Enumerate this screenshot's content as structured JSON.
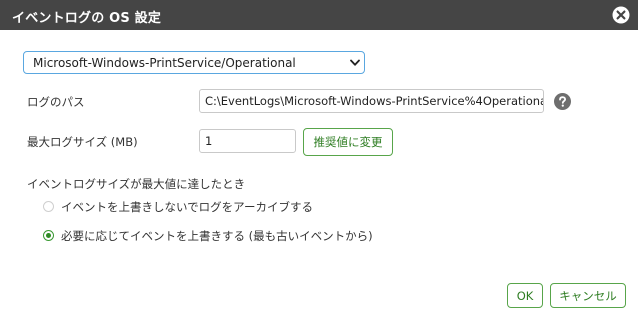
{
  "dialog": {
    "title": "イベントログの OS 設定",
    "close_icon": "close-icon"
  },
  "log_select": {
    "selected": "Microsoft-Windows-PrintService/Operational",
    "chevron_icon": "chevron-down-icon"
  },
  "log_path": {
    "label": "ログのパス",
    "value": "C:\\EventLogs\\Microsoft-Windows-PrintService%4Operational",
    "help_icon": "question-circle-icon"
  },
  "max_size": {
    "label": "最大ログサイズ (MB)",
    "value": "1",
    "recommend_button": "推奨値に変更"
  },
  "on_full": {
    "label": "イベントログサイズが最大値に達したとき",
    "options": [
      {
        "label": "イベントを上書きしないでログをアーカイブする",
        "checked": false
      },
      {
        "label": "必要に応じてイベントを上書きする (最も古いイベントから)",
        "checked": true
      }
    ]
  },
  "footer": {
    "ok_label": "OK",
    "cancel_label": "キャンセル"
  },
  "colors": {
    "titlebar": "#454545",
    "accent_green": "#2e7d22",
    "select_border": "#5aa7e0"
  }
}
